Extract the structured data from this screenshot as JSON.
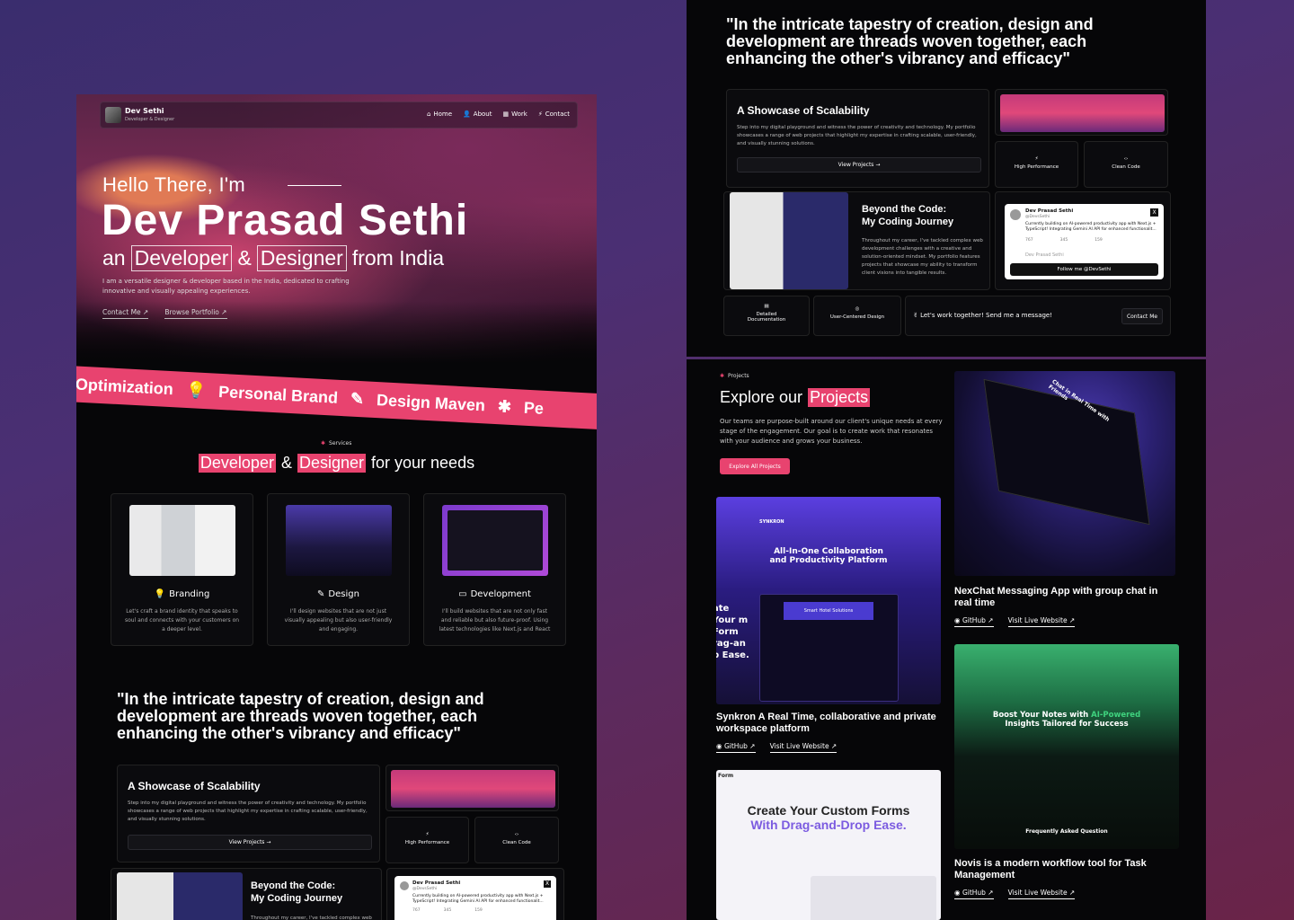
{
  "nav": {
    "name": "Dev Sethi",
    "subtitle": "Developer & Designer",
    "links": [
      "Home",
      "About",
      "Work",
      "Contact"
    ]
  },
  "hero": {
    "greeting": "Hello There, I'm",
    "name": "Dev Prasad Sethi",
    "role_prefix": "an",
    "role_1": "Developer",
    "amp": "&",
    "role_2": "Designer",
    "role_suffix": "from India",
    "description": "I am a versatile designer & developer based in the India, dedicated to crafting innovative and visually appealing experiences.",
    "contact_link": "Contact Me ↗",
    "portfolio_link": "Browse Portfolio ↗"
  },
  "marquee": [
    "Optimization",
    "Personal Brand",
    "Design Maven",
    "Pe"
  ],
  "services": {
    "tag": "Services",
    "heading_1": "Developer",
    "heading_amp": "&",
    "heading_2": "Designer",
    "heading_suffix": "for your needs",
    "cards": [
      {
        "title": "Branding",
        "icon": "lightbulb-icon",
        "desc": "Let's craft a brand identity that speaks to soul and connects with your customers on a deeper level."
      },
      {
        "title": "Design",
        "icon": "tools-icon",
        "desc": "I'll design websites that are not just visually appealing but also user-friendly and engaging."
      },
      {
        "title": "Development",
        "icon": "monitor-icon",
        "desc": "I'll build websites that are not only fast and reliable but also future-proof. Using latest technologies like Next.js and React"
      }
    ]
  },
  "quote": "\"In the intricate tapestry of creation, design and development are threads woven together, each enhancing the other's vibrancy and efficacy\"",
  "showcase": {
    "title": "A Showcase of Scalability",
    "desc": "Step into my digital playground and witness the power of creativity and technology. My portfolio showcases a range of web projects that highlight my expertise in crafting scalable, user-friendly, and visually stunning solutions.",
    "button": "View Projects →",
    "perf": "High Performance",
    "clean": "Clean Code"
  },
  "journey": {
    "title_1": "Beyond the Code:",
    "title_2": "My Coding Journey",
    "desc": "Throughout my career, I've tackled complex web development challenges with a creative and solution-oriented mindset. My portfolio features projects that showcase my ability to transform client visions into tangible results."
  },
  "tweet": {
    "name": "Dev Prasad Sethi",
    "handle": "@DevsSethi",
    "text": "Currently building on AI-powered productivity app with Next.js + TypeScript! Integrating Gemini AI API for enhanced functionalit...",
    "reply": "767",
    "retweet": "345",
    "like": "159",
    "reply_author": "Dev Prasad Sethi",
    "follow": "Follow me @DevSethi"
  },
  "bottom_row": {
    "doc": "Detailed Documentation",
    "ucd": "User-Centered Design",
    "cta": "✌ Let's work together! Send me a message!",
    "cta_btn": "Contact Me"
  },
  "projects": {
    "tag": "Projects",
    "heading_1": "Explore our",
    "heading_2": "Projects",
    "desc": "Our teams are purpose-built around our client's unique needs at every stage of the engagement. Our goal is to create work that resonates with your audience and grows your business.",
    "button": "Explore All Projects",
    "github": "GitHub ↗",
    "live": "Visit Live Website ↗",
    "items": [
      {
        "title": "NexChat Messaging App with group chat in real time"
      },
      {
        "title": "Synkron A Real Time, collaborative and private workspace platform"
      },
      {
        "title": "Novis is a modern workflow tool for Task Management"
      }
    ]
  },
  "synkron_mock": {
    "brand": "SYNKRON",
    "headline": "All-In-One Collaboration and Productivity Platform",
    "sub": "Smart Hotel Solutions",
    "side_text": "ate Your m Form rag-an p Ease."
  },
  "form_mock": {
    "brand": "Form",
    "heading_1": "Create Your Custom Forms",
    "heading_2": "With Drag-and-Drop Ease."
  },
  "novis_mock": {
    "heading_1": "Boost Your Notes with",
    "heading_accent": "AI-Powered",
    "heading_2": "Insights Tailored for Success",
    "faq": "Frequently Asked Question"
  },
  "laptop_mock": {
    "text": "Chat in Real Time with Friends"
  },
  "colors": {
    "accent": "#e8436f",
    "background": "#060608"
  }
}
